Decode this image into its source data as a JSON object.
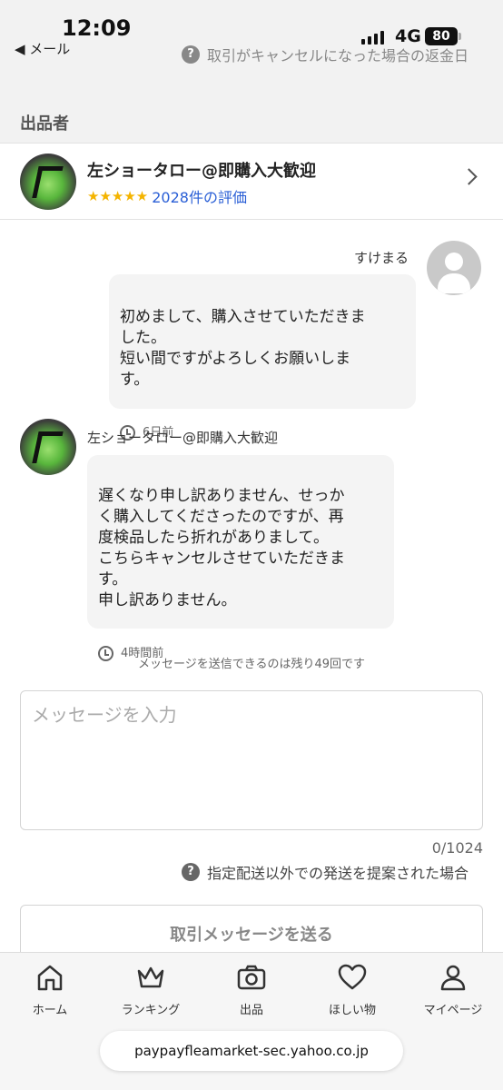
{
  "status_bar": {
    "time": "12:09",
    "back_label": "◀ メール",
    "network": "4G",
    "battery": "80"
  },
  "header": {
    "refund_link": "取引がキャンセルになった場合の返金日"
  },
  "seller_section": {
    "title": "出品者",
    "name": "左ショータロー@即購入大歓迎",
    "stars": "★★★★★",
    "rating_text": "2028件の評価"
  },
  "messages": [
    {
      "sender": "すけまる",
      "text": "初めまして、購入させていただきま\nした。\n短い間ですがよろしくお願いしま\nす。",
      "time": "6日前"
    },
    {
      "sender": "左ショータロー@即購入大歓迎",
      "text": "遅くなり申し訳ありません、せっか\nく購入してくださったのですが、再\n度検品したら折れがありまして。\nこちらキャンセルさせていただきま\nす。\n申し訳ありません。",
      "time": "4時間前"
    }
  ],
  "composer": {
    "remaining_text": "メッセージを送信できるのは残り49回です",
    "placeholder": "メッセージを入力",
    "counter": "0/1024",
    "delivery_link": "指定配送以外での発送を提案された場合",
    "send_label": "取引メッセージを送る"
  },
  "tabbar": {
    "items": [
      {
        "label": "ホーム",
        "icon": "home-icon"
      },
      {
        "label": "ランキング",
        "icon": "crown-icon"
      },
      {
        "label": "出品",
        "icon": "camera-icon"
      },
      {
        "label": "ほしい物",
        "icon": "heart-icon"
      },
      {
        "label": "マイページ",
        "icon": "person-icon"
      }
    ]
  },
  "browser": {
    "url": "paypayfleamarket-sec.yahoo.co.jp"
  },
  "colors": {
    "link_blue": "#2a5fd6",
    "star_yellow": "#f4b400",
    "bubble_bg": "#f4f4f4"
  }
}
